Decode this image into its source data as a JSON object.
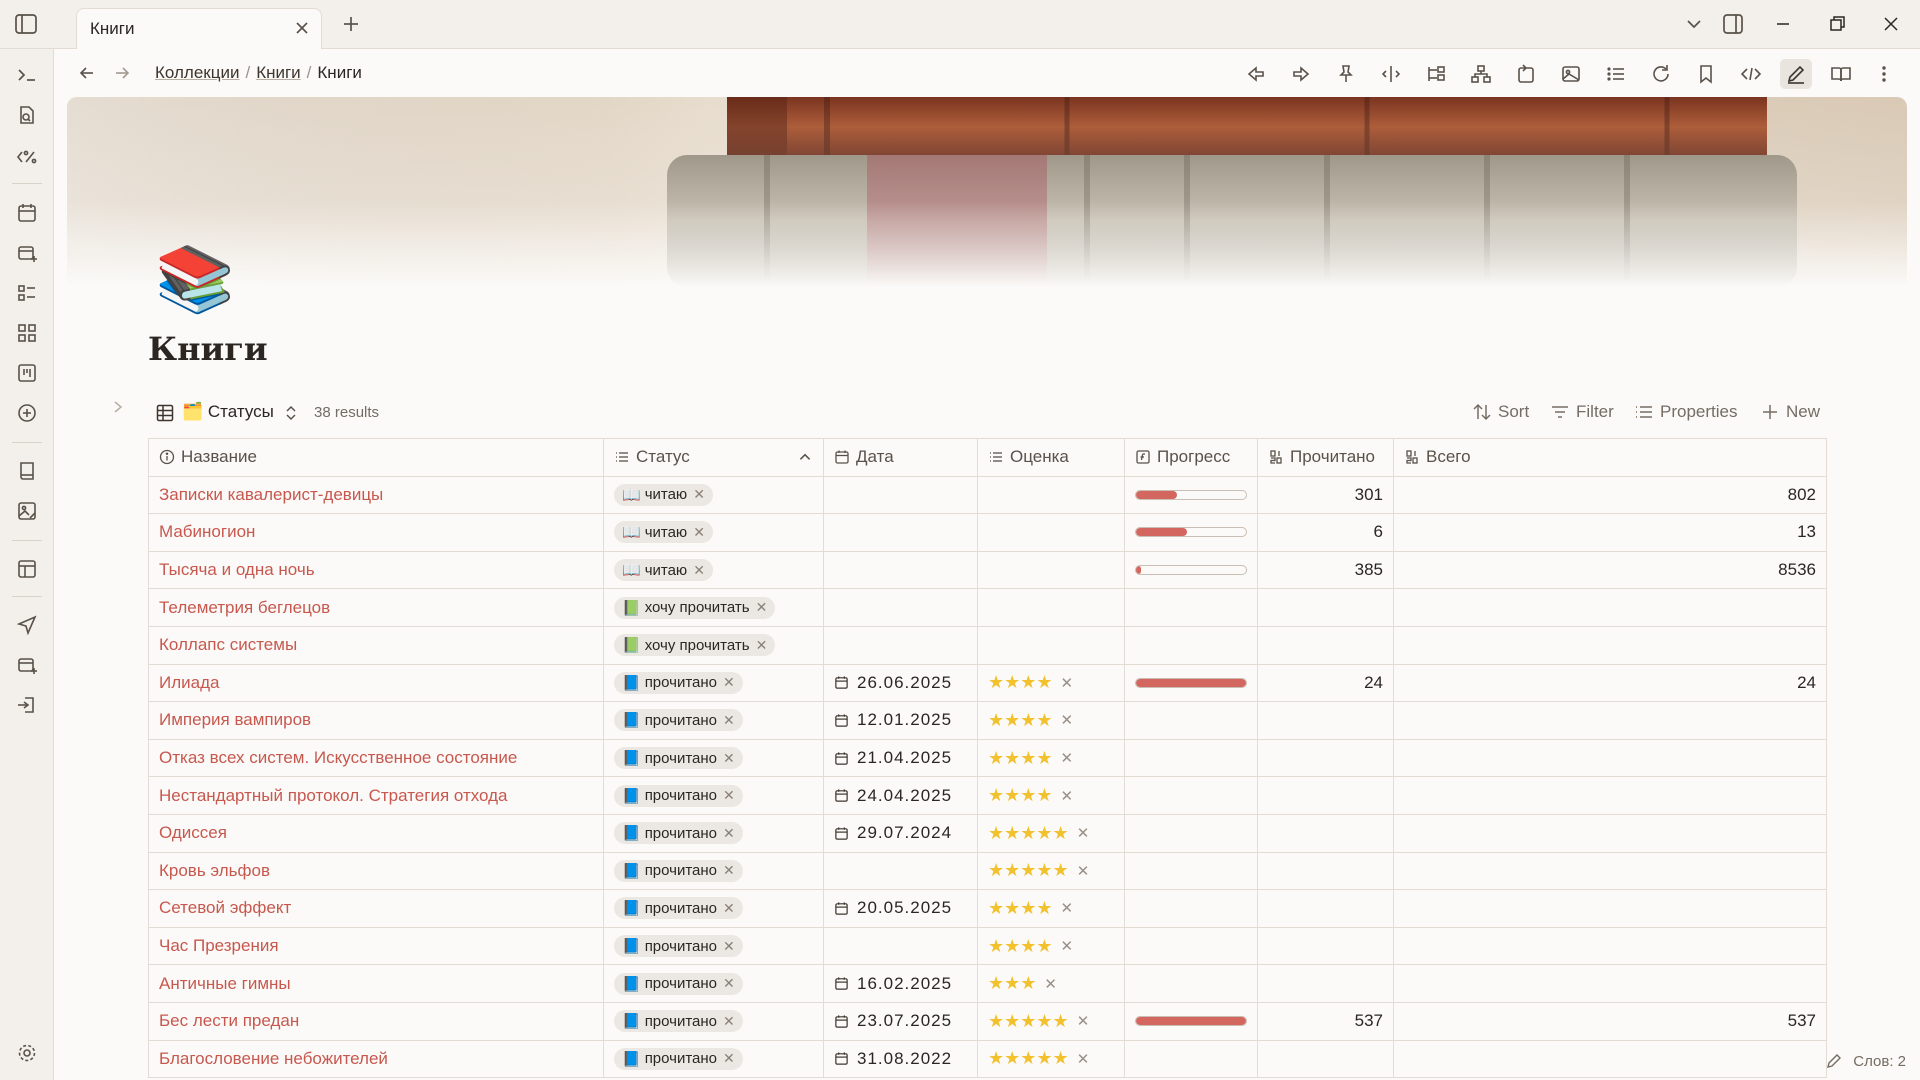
{
  "tab": {
    "title": "Книги"
  },
  "breadcrumb": {
    "items": [
      "Коллекции",
      "Книги",
      "Книги"
    ]
  },
  "page": {
    "emoji": "📚",
    "title": "Книги"
  },
  "view": {
    "name": "🗂️ Статусы",
    "results": "38 results"
  },
  "toolbar": {
    "sort": "Sort",
    "filter": "Filter",
    "properties": "Properties",
    "new": "New"
  },
  "columns": {
    "name": "Название",
    "status": "Статус",
    "date": "Дата",
    "rating": "Оценка",
    "progress": "Прогресс",
    "read": "Прочитано",
    "total": "Всего"
  },
  "rows": [
    {
      "name": "Записки кавалерист-девицы",
      "status_icon": "📖",
      "status": "читаю",
      "date": "",
      "rating": "",
      "progress": 0.375,
      "read": "301",
      "total": "802"
    },
    {
      "name": "Мабиногион",
      "status_icon": "📖",
      "status": "читаю",
      "date": "",
      "rating": "",
      "progress": 0.46,
      "read": "6",
      "total": "13"
    },
    {
      "name": "Тысяча и одна ночь",
      "status_icon": "📖",
      "status": "читаю",
      "date": "",
      "rating": "",
      "progress": 0.045,
      "read": "385",
      "total": "8536"
    },
    {
      "name": "Телеметрия беглецов",
      "status_icon": "📗",
      "status": "хочу прочитать",
      "date": "",
      "rating": "",
      "progress": null,
      "read": "",
      "total": ""
    },
    {
      "name": "Коллапс системы",
      "status_icon": "📗",
      "status": "хочу прочитать",
      "date": "",
      "rating": "",
      "progress": null,
      "read": "",
      "total": ""
    },
    {
      "name": "Илиада",
      "status_icon": "📘",
      "status": "прочитано",
      "date": "26.06.2025",
      "rating": "★★★★",
      "progress": 1,
      "read": "24",
      "total": "24"
    },
    {
      "name": "Империя вампиров",
      "status_icon": "📘",
      "status": "прочитано",
      "date": "12.01.2025",
      "rating": "★★★★",
      "progress": null,
      "read": "",
      "total": ""
    },
    {
      "name": "Отказ всех систем. Искусственное состояние",
      "status_icon": "📘",
      "status": "прочитано",
      "date": "21.04.2025",
      "rating": "★★★★",
      "progress": null,
      "read": "",
      "total": ""
    },
    {
      "name": "Нестандартный протокол. Стратегия отхода",
      "status_icon": "📘",
      "status": "прочитано",
      "date": "24.04.2025",
      "rating": "★★★★",
      "progress": null,
      "read": "",
      "total": ""
    },
    {
      "name": "Одиссея",
      "status_icon": "📘",
      "status": "прочитано",
      "date": "29.07.2024",
      "rating": "★★★★★",
      "progress": null,
      "read": "",
      "total": ""
    },
    {
      "name": "Кровь эльфов",
      "status_icon": "📘",
      "status": "прочитано",
      "date": "",
      "rating": "★★★★★",
      "progress": null,
      "read": "",
      "total": ""
    },
    {
      "name": "Сетевой эффект",
      "status_icon": "📘",
      "status": "прочитано",
      "date": "20.05.2025",
      "rating": "★★★★",
      "progress": null,
      "read": "",
      "total": ""
    },
    {
      "name": "Час Презрения",
      "status_icon": "📘",
      "status": "прочитано",
      "date": "",
      "rating": "★★★★",
      "progress": null,
      "read": "",
      "total": ""
    },
    {
      "name": "Античные гимны",
      "status_icon": "📘",
      "status": "прочитано",
      "date": "16.02.2025",
      "rating": "★★★",
      "progress": null,
      "read": "",
      "total": ""
    },
    {
      "name": "Бес лести предан",
      "status_icon": "📘",
      "status": "прочитано",
      "date": "23.07.2025",
      "rating": "★★★★★",
      "progress": 1,
      "read": "537",
      "total": "537"
    },
    {
      "name": "Благословение небожителей",
      "status_icon": "📘",
      "status": "прочитано",
      "date": "31.08.2022",
      "rating": "★★★★★",
      "progress": null,
      "read": "",
      "total": ""
    }
  ],
  "pill_remove": "✕",
  "statusbar": {
    "words": "Слов: 2"
  },
  "colors": {
    "accent": "#c7584e",
    "progress": "#d3665f",
    "star": "#f2c12e",
    "chrome": "#f3efea"
  }
}
